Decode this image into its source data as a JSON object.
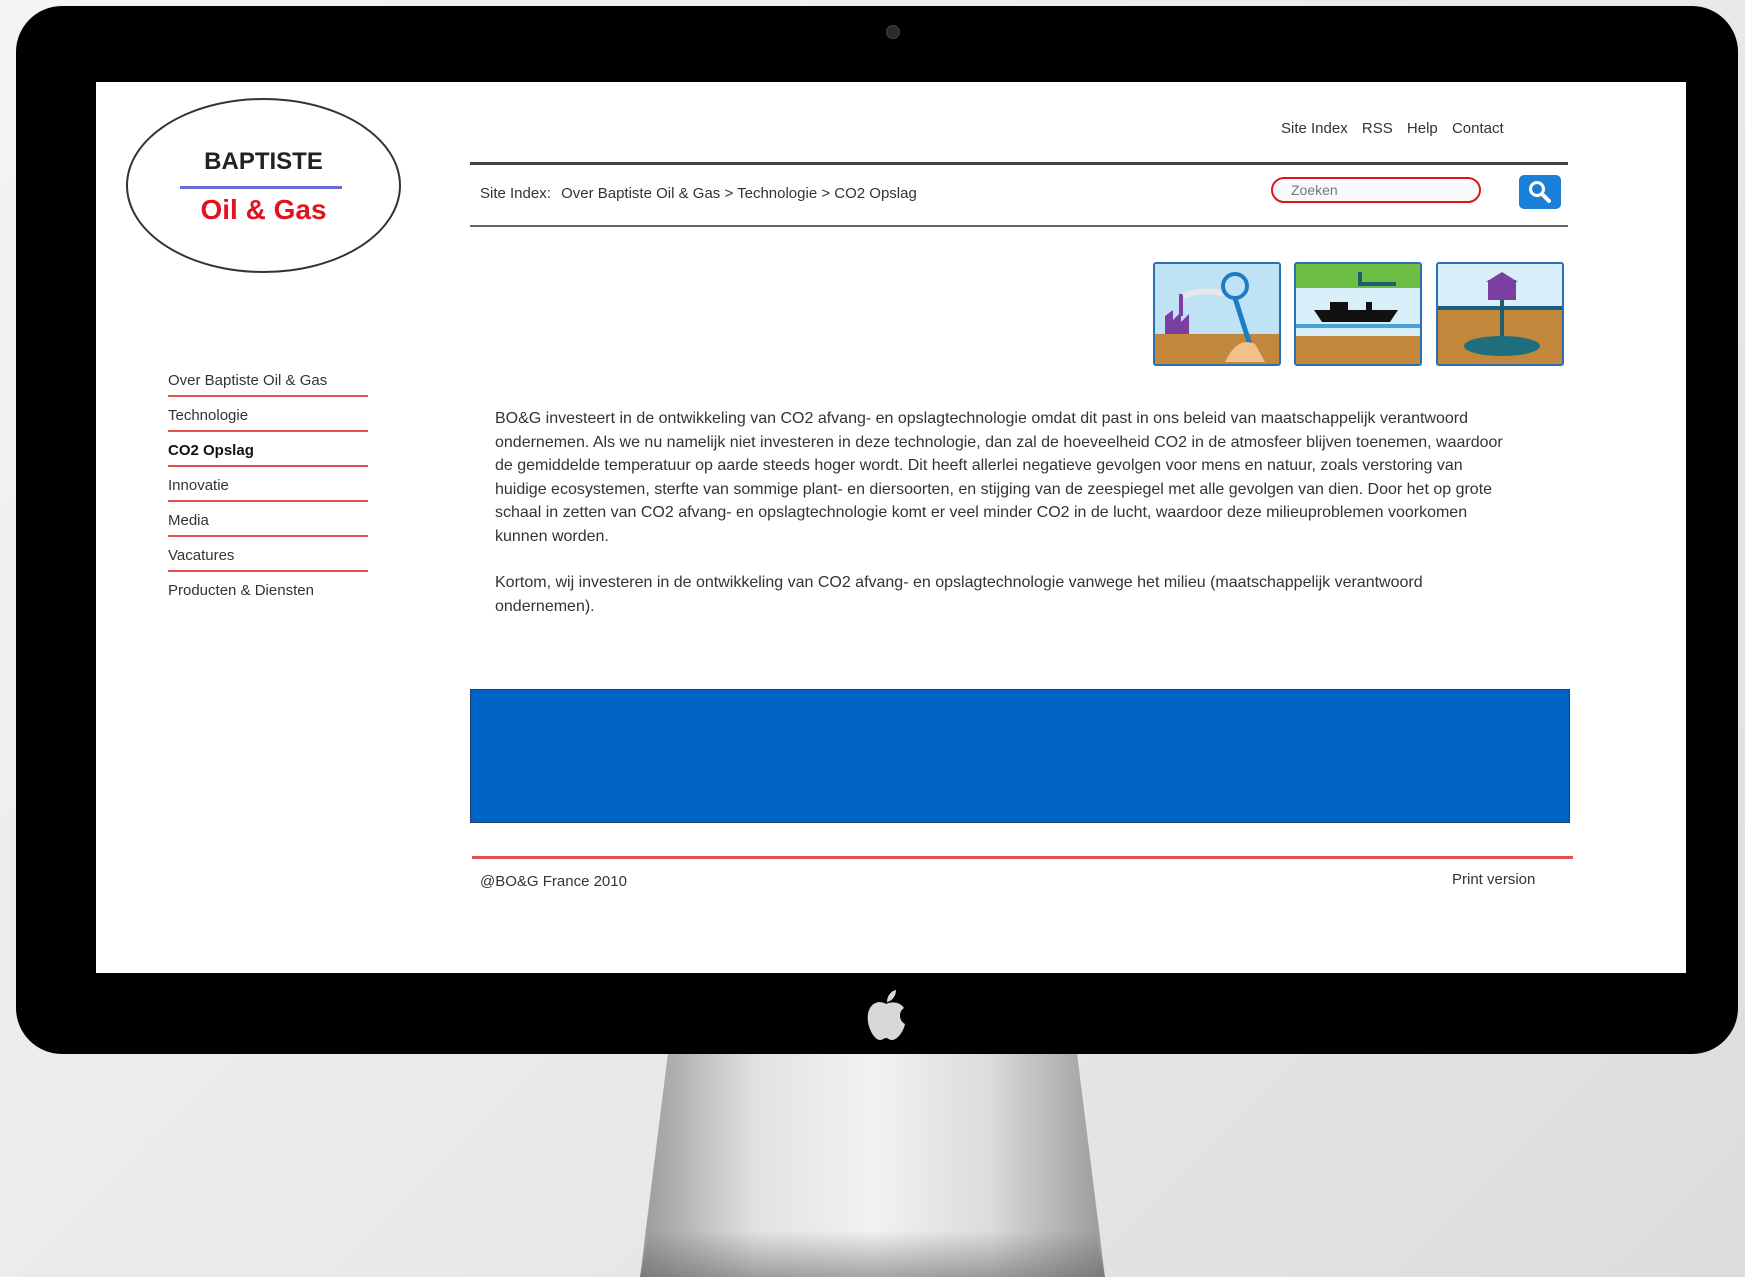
{
  "logo": {
    "top": "BAPTISTE",
    "bottom": "Oil & Gas"
  },
  "toplinks": [
    "Site Index",
    "RSS",
    "Help",
    "Contact"
  ],
  "breadcrumb": {
    "label": "Site Index:",
    "path": "Over Baptiste Oil & Gas > Technologie > CO2 Opslag"
  },
  "search": {
    "placeholder": "Zoeken"
  },
  "nav": {
    "items": [
      "Over Baptiste Oil & Gas",
      "Technologie",
      "CO2 Opslag",
      "Innovatie",
      "Media",
      "Vacatures",
      "Producten & Diensten"
    ],
    "active": "CO2 Opslag"
  },
  "content": {
    "paragraph1": "BO&G investeert in de ontwikkeling van CO2 afvang- en opslagtechnologie omdat dit past in ons beleid van maatschappelijk verantwoord ondernemen. Als we nu namelijk niet investeren in deze technologie, dan zal de hoeveelheid CO2 in de atmosfeer blijven toenemen, waardoor de gemiddelde temperatuur op aarde steeds hoger wordt. Dit heeft allerlei negatieve gevolgen voor mens en natuur, zoals verstoring van huidige ecosystemen, sterfte van sommige plant- en diersoorten, en stijging van de zeespiegel met alle gevolgen van dien. Door het op grote schaal in zetten van CO2 afvang- en opslagtechnologie komt er veel minder CO2 in de lucht, waardoor deze milieuproblemen voorkomen kunnen worden.",
    "paragraph2": "Kortom, wij investeren in de ontwikkeling van CO2 afvang- en opslagtechnologie vanwege het milieu (maatschappelijk verantwoord ondernemen)."
  },
  "footer": {
    "copyright": "@BO&G France 2010",
    "print": "Print version"
  },
  "colors": {
    "accent_red": "#e0141e",
    "banner_blue": "#0063c6",
    "search_button": "#1a7fd6"
  }
}
